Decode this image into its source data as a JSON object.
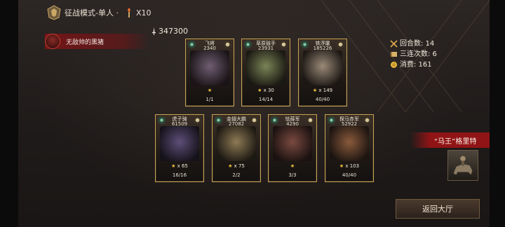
{
  "header": {
    "mode_title": "征战模式-单人 ·",
    "multiplier": "X10"
  },
  "enemy": {
    "name": "无敌帅的黑猪"
  },
  "power": {
    "value": "347300"
  },
  "stats": {
    "rounds": "回合数: 14",
    "triple": "三连次数: 6",
    "cost": "消费: 161"
  },
  "units_top": [
    {
      "name": "飞将",
      "power": "2340",
      "stars": "",
      "count": "1/1",
      "art_color": "#5a4a5c"
    },
    {
      "name": "草原鼓手",
      "power": "23931",
      "stars": "x 30",
      "count": "14/14",
      "art_color": "#5e6a4a"
    },
    {
      "name": "铁浮屠",
      "power": "185226",
      "stars": "x 149",
      "count": "40/40",
      "art_color": "#6a5c4e"
    }
  ],
  "units_bottom": [
    {
      "name": "虎子骑",
      "power": "61509",
      "stars": "x 65",
      "count": "16/16",
      "art_color": "#4a405e"
    },
    {
      "name": "金翅大鹏",
      "power": "27082",
      "stars": "x 75",
      "count": "2/2",
      "art_color": "#6a5a40"
    },
    {
      "name": "怯薛军",
      "power": "4290",
      "stars": "",
      "count": "3/3",
      "art_color": "#5a3a34"
    },
    {
      "name": "探马赤军",
      "power": "52922",
      "stars": "x 103",
      "count": "40/40",
      "art_color": "#6a4632"
    }
  ],
  "king": {
    "label": "“马王”格里特"
  },
  "buttons": {
    "back": "返回大厅"
  },
  "colors": {
    "accent_gold": "#c6a257",
    "accent_red": "#96141a",
    "star": "#f4c53e"
  }
}
